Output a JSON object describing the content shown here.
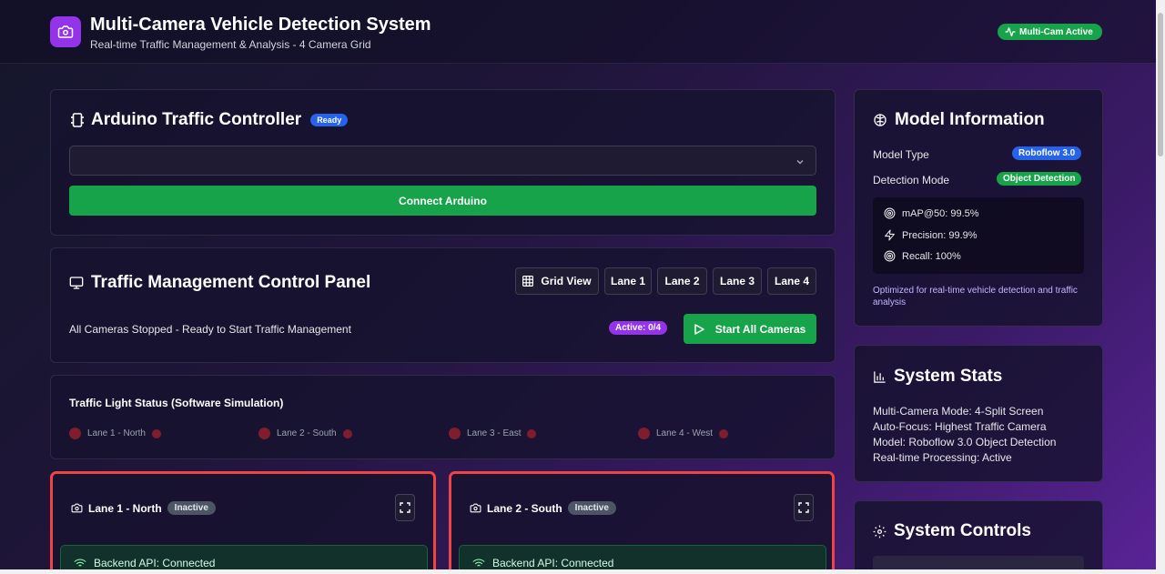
{
  "header": {
    "title": "Multi-Camera Vehicle Detection System",
    "subtitle": "Real-time Traffic Management & Analysis - 4 Camera Grid",
    "status_badge": "Multi-Cam Active"
  },
  "arduino": {
    "title": "Arduino Traffic Controller",
    "status": "Ready",
    "port_select_value": "",
    "connect_label": "Connect Arduino"
  },
  "control_panel": {
    "title": "Traffic Management Control Panel",
    "view_buttons": [
      "Grid View",
      "Lane 1",
      "Lane 2",
      "Lane 3",
      "Lane 4"
    ],
    "status_text": "All Cameras Stopped - Ready to Start Traffic Management",
    "active_count": "Active: 0/4",
    "start_label": "Start All Cameras"
  },
  "traffic_lights": {
    "title": "Traffic Light Status (Software Simulation)",
    "lanes": [
      "Lane 1 - North",
      "Lane 2 - South",
      "Lane 3 - East",
      "Lane 4 - West"
    ]
  },
  "cameras": [
    {
      "name": "Lane 1 - North",
      "status": "Inactive",
      "backend": "Backend API: Connected"
    },
    {
      "name": "Lane 2 - South",
      "status": "Inactive",
      "backend": "Backend API: Connected"
    }
  ],
  "model_info": {
    "title": "Model Information",
    "model_type_label": "Model Type",
    "model_type_value": "Roboflow 3.0",
    "detection_mode_label": "Detection Mode",
    "detection_mode_value": "Object Detection",
    "metrics": [
      "mAP@50: 99.5%",
      "Precision: 99.9%",
      "Recall: 100%"
    ],
    "note": "Optimized for real-time vehicle detection and traffic analysis"
  },
  "system_stats": {
    "title": "System Stats",
    "lines": [
      "Multi-Camera Mode: 4-Split Screen",
      "Auto-Focus: Highest Traffic Camera",
      "Model: Roboflow 3.0 Object Detection",
      "Real-time Processing: Active"
    ]
  },
  "system_controls": {
    "title": "System Controls"
  },
  "colors": {
    "accent_purple": "#9333ea",
    "success_green": "#16a34a",
    "info_blue": "#2563eb",
    "inactive_red": "#ef4444"
  }
}
